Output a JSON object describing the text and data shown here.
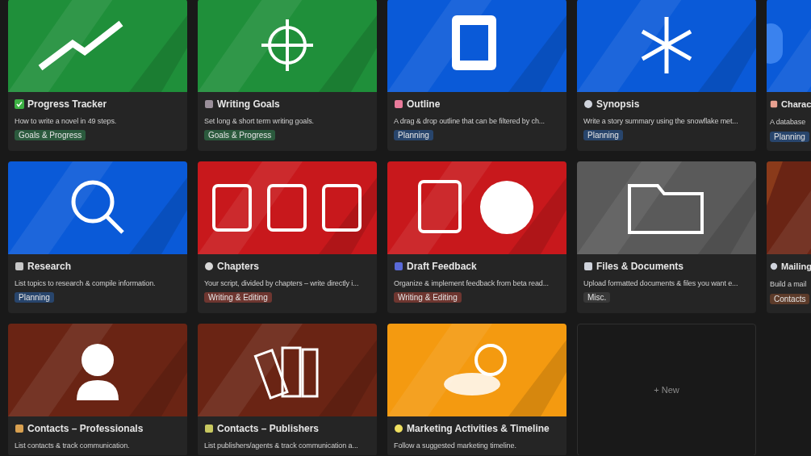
{
  "gallery": {
    "cards": [
      {
        "title": "Progress Tracker",
        "description": "How to write a novel in 49 steps.",
        "tag": "Goals & Progress",
        "color": "#1f8f3a"
      },
      {
        "title": "Writing Goals",
        "description": "Set long & short term writing goals.",
        "tag": "Goals & Progress",
        "color": "#1f8f3a"
      },
      {
        "title": "Outline",
        "description": "A drag & drop outline that can be filtered by ch...",
        "tag": "Planning",
        "color": "#0a5ad8"
      },
      {
        "title": "Synopsis",
        "description": "Write a story summary using the snowflake met...",
        "tag": "Planning",
        "color": "#0a5ad8"
      },
      {
        "title": "Charac",
        "description": "A database",
        "tag": "Planning",
        "color": "#0a5ad8",
        "kind": "partial"
      },
      {
        "title": "Research",
        "description": "List topics to research & compile information.",
        "tag": "Planning",
        "color": "#0a5ad8"
      },
      {
        "title": "Chapters",
        "description": "Your script, divided by chapters – write directly i...",
        "tag": "Writing & Editing",
        "color": "#c8181c"
      },
      {
        "title": "Draft Feedback",
        "description": "Organize & implement feedback from beta read...",
        "tag": "Writing & Editing",
        "color": "#c8181c"
      },
      {
        "title": "Files & Documents",
        "description": "Upload formatted documents & files you want e...",
        "tag": "Misc.",
        "color": "#5a5a5a"
      },
      {
        "title": "Mailing",
        "description": "Build a mail",
        "tag": "Contacts",
        "color": "#6a2414",
        "kind": "partial"
      },
      {
        "title": "Contacts – Professionals",
        "description": "List contacts & track communication.",
        "color": "#6a2414"
      },
      {
        "title": "Contacts – Publishers",
        "description": "List publishers/agents & track communication a...",
        "color": "#6a2414"
      },
      {
        "title": "Marketing Activities & Timeline",
        "description": "Follow a suggested marketing timeline.",
        "color": "#f49a10"
      }
    ],
    "new_button": "+ New"
  }
}
